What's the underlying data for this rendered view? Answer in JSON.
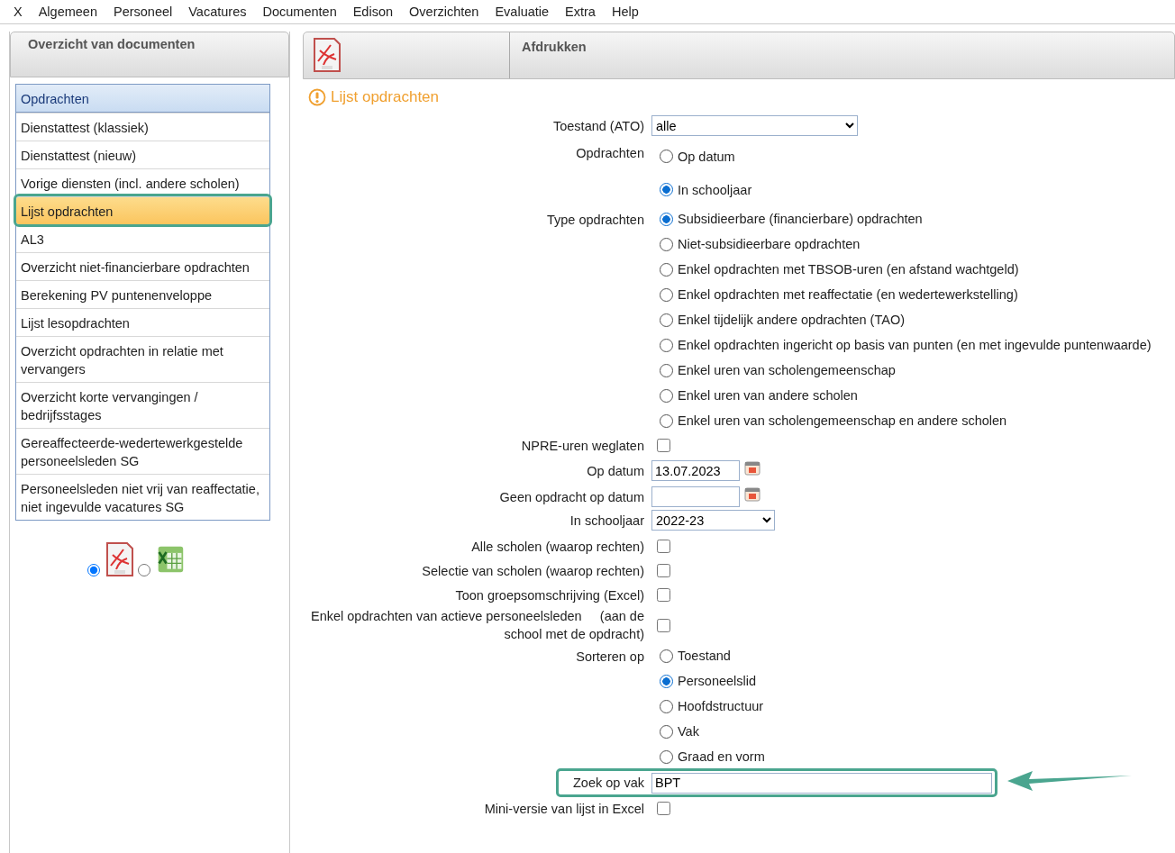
{
  "menu": [
    {
      "label": "X"
    },
    {
      "label": "Algemeen"
    },
    {
      "label": "Personeel"
    },
    {
      "label": "Vacatures"
    },
    {
      "label": "Documenten"
    },
    {
      "label": "Edison"
    },
    {
      "label": "Overzichten"
    },
    {
      "label": "Evaluatie"
    },
    {
      "label": "Extra"
    },
    {
      "label": "Help"
    }
  ],
  "left_panel": {
    "title": "Overzicht van documenten",
    "items": [
      {
        "label": "Opdrachten",
        "kind": "header",
        "selected": false,
        "highlighted": false
      },
      {
        "label": "Dienstattest (klassiek)",
        "kind": "item",
        "selected": false,
        "highlighted": false
      },
      {
        "label": "Dienstattest (nieuw)",
        "kind": "item",
        "selected": false,
        "highlighted": false
      },
      {
        "label": "Vorige diensten (incl. andere scholen)",
        "kind": "item",
        "selected": false,
        "highlighted": false
      },
      {
        "label": "Lijst opdrachten",
        "kind": "item",
        "selected": true,
        "highlighted": true
      },
      {
        "label": "AL3",
        "kind": "item",
        "selected": false,
        "highlighted": false
      },
      {
        "label": "Overzicht niet-financierbare opdrachten",
        "kind": "item",
        "selected": false,
        "highlighted": false
      },
      {
        "label": "Berekening PV puntenenveloppe",
        "kind": "item",
        "selected": false,
        "highlighted": false
      },
      {
        "label": "Lijst lesopdrachten",
        "kind": "item",
        "selected": false,
        "highlighted": false
      },
      {
        "label": "Overzicht opdrachten in relatie met vervangers",
        "kind": "item",
        "selected": false,
        "highlighted": false
      },
      {
        "label": "Overzicht korte vervangingen / bedrijfsstages",
        "kind": "item",
        "selected": false,
        "highlighted": false
      },
      {
        "label": "Gereaffecteerde-wedertewerkgestelde personeelsleden SG",
        "kind": "item",
        "selected": false,
        "highlighted": false
      },
      {
        "label": "Personeelsleden niet vrij van reaffectatie, niet ingevulde vacatures SG",
        "kind": "item",
        "selected": false,
        "highlighted": false
      }
    ],
    "export_formats": [
      {
        "kind": "pdf",
        "selected": true
      },
      {
        "kind": "excel",
        "selected": false
      }
    ]
  },
  "right_panel": {
    "header_title": "Afdrukken",
    "heading": "Lijst opdrachten",
    "fields": [
      {
        "kind": "select",
        "label": "Toestand (ATO)",
        "value": "alle",
        "highlighted": false
      },
      {
        "kind": "radios",
        "label": "Opdrachten",
        "highlighted": false,
        "options": [
          {
            "label": "Op datum",
            "selected": false
          },
          {
            "label": "In schooljaar",
            "selected": true
          }
        ]
      },
      {
        "kind": "radios",
        "label": "Type opdrachten",
        "highlighted": false,
        "options": [
          {
            "label": "Subsidieerbare (financierbare) opdrachten",
            "selected": true
          },
          {
            "label": "Niet-subsidieerbare opdrachten",
            "selected": false
          },
          {
            "label": "Enkel opdrachten met TBSOB-uren (en afstand wachtgeld)",
            "selected": false
          },
          {
            "label": "Enkel opdrachten met reaffectatie (en wedertewerkstelling)",
            "selected": false
          },
          {
            "label": "Enkel tijdelijk andere opdrachten (TAO)",
            "selected": false
          },
          {
            "label": "Enkel opdrachten ingericht op basis van punten (en met ingevulde puntenwaarde)",
            "selected": false
          },
          {
            "label": "Enkel uren van scholengemeenschap",
            "selected": false
          },
          {
            "label": "Enkel uren van andere scholen",
            "selected": false
          },
          {
            "label": "Enkel uren van scholengemeenschap en andere scholen",
            "selected": false
          }
        ]
      },
      {
        "kind": "checkbox",
        "label": "NPRE-uren weglaten",
        "checked": false,
        "highlighted": false
      },
      {
        "kind": "date",
        "label": "Op datum",
        "value": "13.07.2023",
        "highlighted": false
      },
      {
        "kind": "date",
        "label": "Geen opdracht op datum",
        "highlighted": false
      },
      {
        "kind": "select",
        "label": "In schooljaar",
        "value": "2022-23",
        "highlighted": false
      },
      {
        "kind": "checkbox",
        "label": "Alle scholen (waarop rechten)",
        "checked": false,
        "highlighted": false
      },
      {
        "kind": "checkbox",
        "label": "Selectie van scholen (waarop rechten)",
        "checked": false,
        "highlighted": false
      },
      {
        "kind": "checkbox",
        "label": "Toon groepsomschrijving (Excel)",
        "checked": false,
        "highlighted": false
      },
      {
        "kind": "checkbox",
        "label": "Enkel opdrachten van actieve personeelsleden     (aan de school met de opdracht)",
        "checked": false,
        "highlighted": false
      },
      {
        "kind": "radios",
        "label": "Sorteren op",
        "highlighted": false,
        "options": [
          {
            "label": "Toestand",
            "selected": false
          },
          {
            "label": "Personeelslid",
            "selected": true
          },
          {
            "label": "Hoofdstructuur",
            "selected": false
          },
          {
            "label": "Vak",
            "selected": false
          },
          {
            "label": "Graad en vorm",
            "selected": false
          }
        ]
      },
      {
        "kind": "text",
        "label": "Zoek op vak",
        "value": "BPT",
        "highlighted": true
      },
      {
        "kind": "checkbox",
        "label": "Mini-versie van lijst in Excel",
        "checked": false,
        "highlighted": false
      }
    ]
  }
}
